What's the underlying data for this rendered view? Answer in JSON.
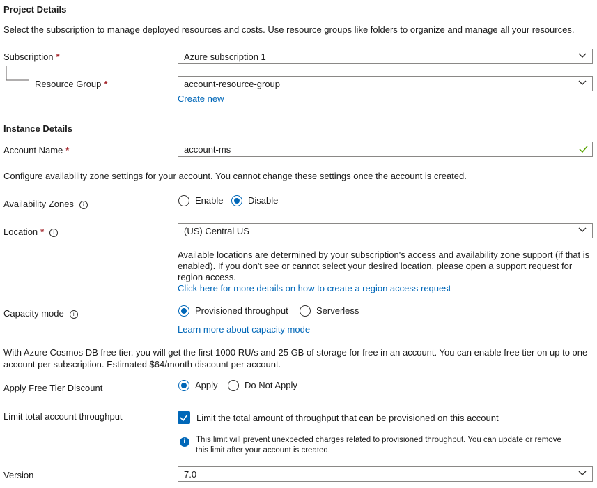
{
  "project": {
    "title": "Project Details",
    "description": "Select the subscription to manage deployed resources and costs. Use resource groups like folders to organize and manage all your resources.",
    "subscription_label": "Subscription",
    "subscription_value": "Azure subscription 1",
    "resource_group_label": "Resource Group",
    "resource_group_value": "account-resource-group",
    "create_new": "Create new",
    "required_mark": "*"
  },
  "instance": {
    "title": "Instance Details",
    "account_name_label": "Account Name",
    "account_name_value": "account-ms",
    "az_description": "Configure availability zone settings for your account. You cannot change these settings once the account is created.",
    "az_label": "Availability Zones",
    "az_options": [
      "Enable",
      "Disable"
    ],
    "az_selected": "Disable",
    "location_label": "Location",
    "location_value": "(US) Central US",
    "location_help_1": "Available locations are determined by your subscription's access and availability zone support (if that is",
    "location_help_2": "enabled). If you don't see or cannot select your desired location, please open a support request for",
    "location_help_3": "region access.",
    "location_link": "Click here for more details on how to create a region access request",
    "capacity_label": "Capacity mode",
    "capacity_options": [
      "Provisioned throughput",
      "Serverless"
    ],
    "capacity_selected": "Provisioned throughput",
    "capacity_link": "Learn more about capacity mode",
    "free_tier_text_1": "With Azure Cosmos DB free tier, you will get the first 1000 RU/s and 25 GB of storage for free in an account. You can enable free tier on up to one",
    "free_tier_text_2": "account per subscription. Estimated $64/month discount per account.",
    "free_tier_label": "Apply Free Tier Discount",
    "free_tier_options": [
      "Apply",
      "Do Not Apply"
    ],
    "free_tier_selected": "Apply",
    "limit_label": "Limit total account throughput",
    "limit_checkbox_label": "Limit the total amount of throughput that can be provisioned on this account",
    "limit_checked": true,
    "limit_info_1": "This limit will prevent unexpected charges related to provisioned throughput. You can update or remove",
    "limit_info_2": "this limit after your account is created.",
    "version_label": "Version",
    "version_value": "7.0"
  },
  "icons": {
    "info": "info-icon",
    "dropdown": "chevron-down-icon",
    "valid": "checkmark-icon"
  },
  "colors": {
    "accent": "#0067b8",
    "required": "#a4262c",
    "border": "#8a8886",
    "valid_check": "#57a300"
  }
}
